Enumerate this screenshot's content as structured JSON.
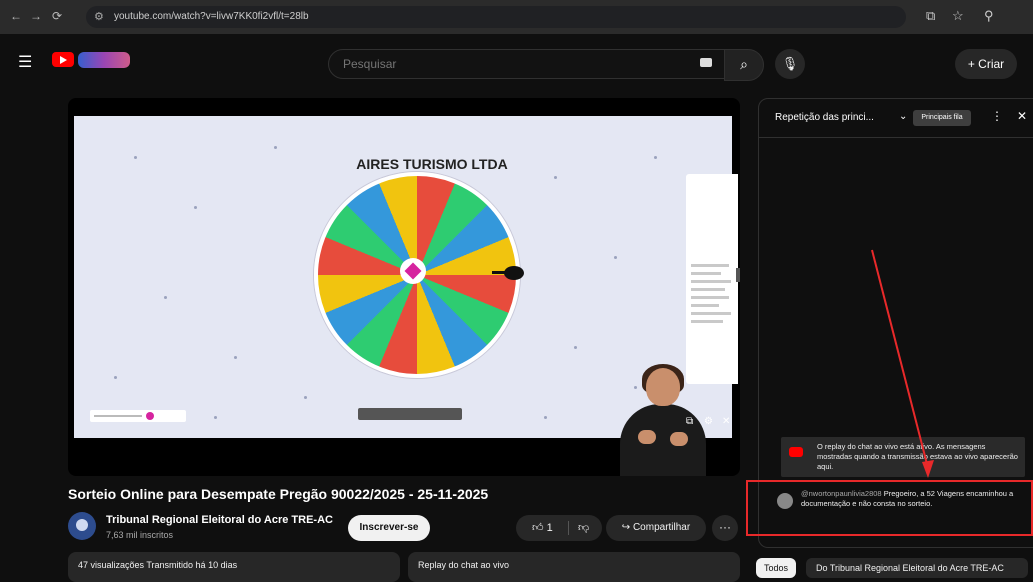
{
  "browser": {
    "url": "youtube.com/watch?v=livw7KK0fi2vfl/t=28lb",
    "nav_icons": [
      "back-icon",
      "forward-icon",
      "reload-icon",
      "site-info-icon"
    ],
    "right_icons": [
      "cast-icon",
      "star-icon",
      "extensions-icon"
    ]
  },
  "youtube_header": {
    "search_placeholder": "Pesquisar",
    "create_label": "+ Criar"
  },
  "video": {
    "wheel_title": "AIRES TURISMO LTDA",
    "title": "Sorteio Online para Desempate Pregão 90022/2025 - 25-11-2025",
    "channel_name": "Tribunal Regional Eleitoral do Acre TRE-AC",
    "subscribers": "7,63 mil inscritos",
    "subscribe_label": "Inscrever-se",
    "like_count": "1",
    "share_label": "Compartilhar",
    "more_label": "···",
    "description_summary": "47 visualizações  Transmitido há 10 dias",
    "replay_label": "Replay do chat ao vivo"
  },
  "chat": {
    "title": "Repetição das princi...",
    "mode_label": "Principais fila",
    "notice": "O replay do chat ao vivo está ativo. As mensagens mostradas quando a transmissão estava ao vivo aparecerão aqui.",
    "message_user": "@nwortonpaunlivia2808",
    "message_text": "Pregoeiro, a 52 Viagens encaminhou a documentação e não consta no sorteio.",
    "tabs": [
      "Todos",
      "Do Tribunal Regional Eleitoral do Acre TRE-AC"
    ]
  },
  "colors": {
    "annotation_red": "#e8292a",
    "youtube_red": "#ff0000",
    "accent_pink": "#d6249f"
  }
}
